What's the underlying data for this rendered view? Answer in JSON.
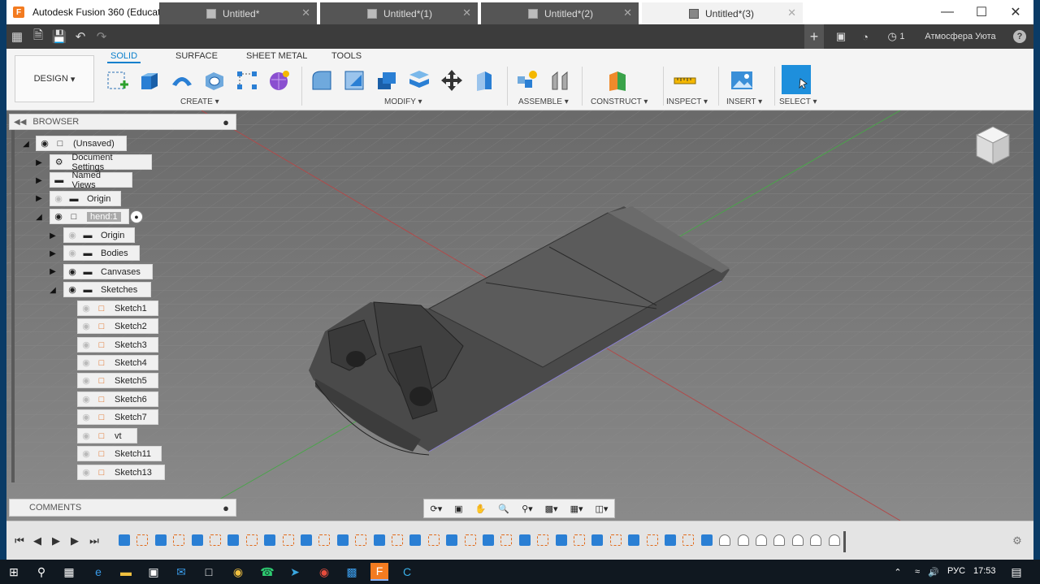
{
  "window": {
    "title": "Autodesk Fusion 360 (Education License)",
    "logo": "F"
  },
  "tabs": [
    {
      "label": "Untitled*"
    },
    {
      "label": "Untitled*(1)"
    },
    {
      "label": "Untitled*(2)"
    },
    {
      "label": "Untitled*(3)",
      "active": true
    }
  ],
  "header_right": {
    "jobs_count": "1",
    "user_name": "Атмосфера Уюта",
    "help": "?"
  },
  "toolbar": {
    "workspace": "DESIGN",
    "workspace_tabs": [
      "SOLID",
      "SURFACE",
      "SHEET METAL",
      "TOOLS"
    ],
    "groups": [
      "CREATE",
      "MODIFY",
      "ASSEMBLE",
      "CONSTRUCT",
      "INSPECT",
      "INSERT",
      "SELECT"
    ],
    "accent": "#0a7fcc"
  },
  "browser": {
    "title": "BROWSER",
    "root": "(Unsaved)",
    "items": [
      {
        "label": "Document Settings",
        "icon": "gear-icon"
      },
      {
        "label": "Named Views",
        "icon": "folder-icon"
      },
      {
        "label": "Origin",
        "icon": "folder-icon"
      },
      {
        "label": "hend:1",
        "icon": "component-icon"
      },
      {
        "label": "Origin",
        "icon": "folder-icon"
      },
      {
        "label": "Bodies",
        "icon": "folder-icon"
      },
      {
        "label": "Canvases",
        "icon": "folder-icon"
      },
      {
        "label": "Sketches",
        "icon": "folder-icon"
      }
    ],
    "sketches": [
      "Sketch1",
      "Sketch2",
      "Sketch3",
      "Sketch4",
      "Sketch5",
      "Sketch6",
      "Sketch7",
      "vt",
      "Sketch11",
      "Sketch13"
    ]
  },
  "comments": {
    "title": "COMMENTS"
  },
  "taskbar": {
    "language": "РУС",
    "time": "17:53"
  }
}
